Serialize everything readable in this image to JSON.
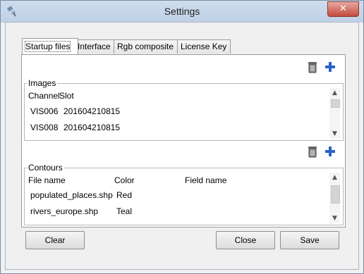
{
  "window": {
    "title": "Settings",
    "close_label": "✕"
  },
  "tabs": [
    {
      "label": "Startup files",
      "active": true
    },
    {
      "label": "Interface",
      "active": false
    },
    {
      "label": "Rgb composite",
      "active": false
    },
    {
      "label": "License Key",
      "active": false
    }
  ],
  "images": {
    "group_title": "Images",
    "columns": [
      "Channel",
      "Slot"
    ],
    "rows": [
      {
        "channel": "VIS006",
        "slot": "201604210815"
      },
      {
        "channel": "VIS008",
        "slot": "201604210815"
      }
    ]
  },
  "contours": {
    "group_title": "Contours",
    "columns": [
      "File name",
      "Color",
      "Field name"
    ],
    "rows": [
      {
        "file": "populated_places.shp",
        "color": "Red",
        "field": ""
      },
      {
        "file": "rivers_europe.shp",
        "color": "Teal",
        "field": ""
      }
    ]
  },
  "buttons": {
    "clear": "Clear",
    "close": "Close",
    "save": "Save"
  },
  "icons": {
    "delete": "trash-icon",
    "add": "plus-icon",
    "app": "satellite-icon"
  }
}
